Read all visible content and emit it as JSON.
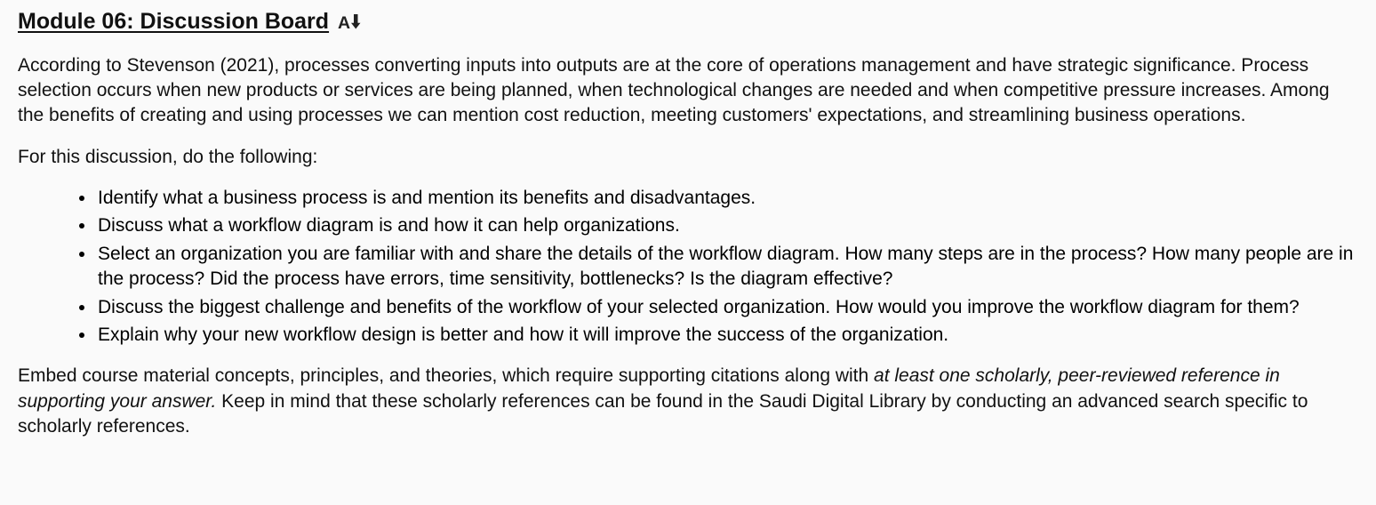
{
  "heading": {
    "title": "Module 06: Discussion Board"
  },
  "intro_paragraph": "According to Stevenson (2021), processes converting inputs into outputs are at the core of operations management and have strategic significance. Process selection occurs when new products or services are being planned, when technological changes are needed and when competitive pressure increases. Among the benefits of creating and using processes we can mention cost reduction, meeting customers' expectations, and streamlining business operations.",
  "instructions_lead": "For this discussion, do the following:",
  "bullets": [
    "Identify what a business process is and mention its benefits and disadvantages.",
    "Discuss what a workflow diagram is and how it can help organizations.",
    "Select an organization you are familiar with and share the details of the workflow diagram. How many steps are in the process? How many people are in the process? Did the process have errors, time sensitivity, bottlenecks? Is the diagram effective?",
    "Discuss the biggest challenge and benefits of the workflow of your selected organization. How would you improve the workflow diagram for them?",
    "Explain why your new workflow design is better and how it will improve the success of the organization."
  ],
  "closing": {
    "pre": "Embed course material concepts, principles, and theories, which require supporting citations along with ",
    "italic": "at least one scholarly, peer-reviewed reference in supporting your answer.",
    "post": " Keep in mind that these scholarly references can be found in the Saudi Digital Library by conducting an advanced search specific to scholarly references."
  }
}
